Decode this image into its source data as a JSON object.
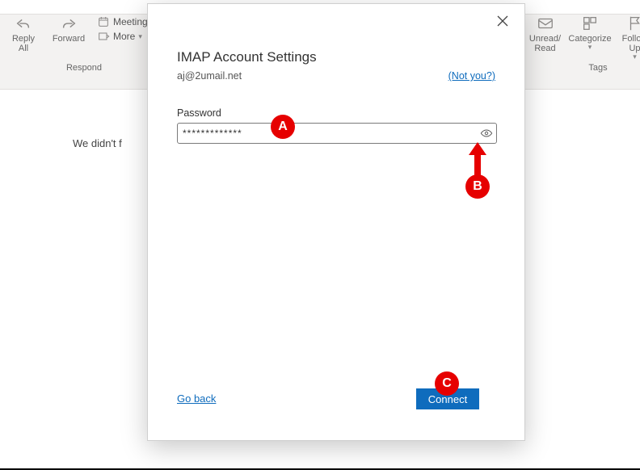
{
  "ribbon": {
    "respond": {
      "reply_all": "Reply\nAll",
      "forward": "Forward",
      "meeting": "Meeting",
      "more": "More",
      "group_label": "Respond"
    },
    "tags": {
      "unread_read": "Unread/\nRead",
      "categorize": "Categorize",
      "follow_up": "Follow\nUp",
      "group_label": "Tags"
    }
  },
  "background_text": "We didn't f",
  "dialog": {
    "title": "IMAP Account Settings",
    "email": "aj@2umail.net",
    "not_you": "(Not you?)",
    "password_label": "Password",
    "password_value": "*************",
    "go_back": "Go back",
    "connect": "Connect"
  },
  "annotations": {
    "a": "A",
    "b": "B",
    "c": "C"
  }
}
